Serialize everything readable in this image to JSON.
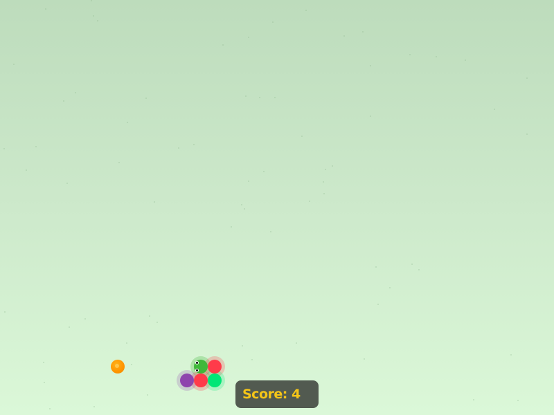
{
  "game": {
    "score_label": "Score: 4",
    "score": 4
  },
  "snake": {
    "segments": [
      {
        "role": "head",
        "color": "#3fb83a",
        "halo": "rgba(63,184,58,0.28)"
      },
      {
        "role": "body",
        "color": "#ff3b4a",
        "halo": "rgba(255,59,74,0.25)"
      },
      {
        "role": "body",
        "color": "#00e676",
        "halo": "rgba(0,230,118,0.22)"
      },
      {
        "role": "body",
        "color": "#ff3b4a",
        "halo": "rgba(255,59,74,0.25)"
      },
      {
        "role": "body",
        "color": "#8e44ad",
        "halo": "rgba(142,68,173,0.22)"
      }
    ]
  },
  "food": {
    "color": "#ff9500",
    "icon": "orange-food-icon"
  },
  "colors": {
    "background_top": "#bddcbc",
    "background_bottom": "#dbf8d8",
    "score_panel": "#525a50",
    "score_text": "#f5c518"
  }
}
